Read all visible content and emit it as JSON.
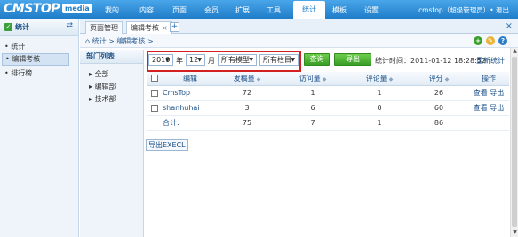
{
  "app": {
    "logo_text": "CMSTOP",
    "logo_badge": "media"
  },
  "nav": {
    "items": [
      "我的",
      "内容",
      "页面",
      "会员",
      "扩展",
      "工具",
      "统计",
      "模板",
      "设置"
    ],
    "active": "统计"
  },
  "user": {
    "text": "cmstop（超级管理员）• 退出"
  },
  "sidebar": {
    "title": "统计",
    "items": [
      {
        "label": "统计"
      },
      {
        "label": "编辑考核"
      },
      {
        "label": "排行榜"
      }
    ]
  },
  "tabs": [
    {
      "label": "页面管理"
    },
    {
      "label": "编辑考核",
      "close": "×"
    }
  ],
  "breadcrumb": "统计 > 编辑考核 >",
  "dept": {
    "title": "部门列表",
    "items": [
      "全部",
      "编辑部",
      "技术部"
    ]
  },
  "filters": {
    "year": "2010",
    "year_label": "年",
    "month": "12",
    "month_label": "月",
    "model": "所有模型",
    "column": "所有栏目",
    "query_button": "查询",
    "export_button": "导出EXECL",
    "stat_time_label": "统计时间：",
    "stat_time_value": "2011-01-12 18:28:52",
    "restat_link": "重新统计"
  },
  "table": {
    "headers": [
      "编辑",
      "发稿量",
      "访问量",
      "评论量",
      "评分",
      "操作"
    ],
    "rows": [
      {
        "name": "CmsTop",
        "posts": "72",
        "visits": "1",
        "comments": "1",
        "score": "26",
        "view": "查看",
        "export": "导出"
      },
      {
        "name": "shanhuhai",
        "posts": "3",
        "visits": "6",
        "comments": "0",
        "score": "60",
        "view": "查看",
        "export": "导出"
      }
    ],
    "total": {
      "label": "合计:",
      "posts": "75",
      "visits": "7",
      "comments": "1",
      "score": "86"
    }
  },
  "bottom_export": "导出EXECL",
  "colors": {
    "accent": "#1f7cc8",
    "highlight_border": "#d32020",
    "green_button": "#3b9e25"
  }
}
